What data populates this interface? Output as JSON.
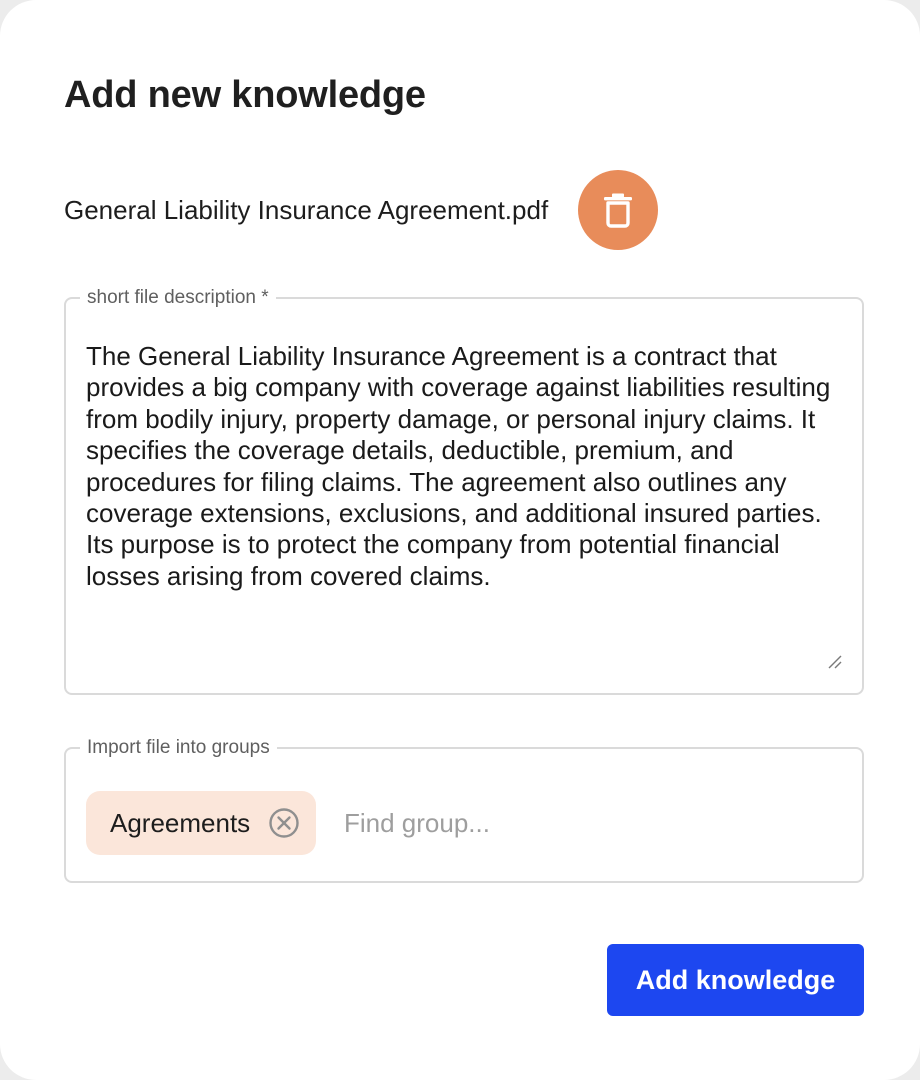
{
  "dialog": {
    "title": "Add new knowledge"
  },
  "file": {
    "name": "General Liability Insurance Agreement.pdf",
    "delete_icon": "trash-icon",
    "delete_color": "#e88c5a"
  },
  "description": {
    "label": "short file description *",
    "value": "The General Liability Insurance Agreement is a contract that provides a big company with coverage against liabilities resulting from bodily injury, property damage, or personal injury claims. It specifies the coverage details, deductible, premium, and procedures for filing claims. The agreement also outlines any coverage extensions, exclusions, and additional insured parties. Its purpose is to protect the company from potential financial losses arising from covered claims."
  },
  "groups": {
    "label": "Import file into groups",
    "selected": [
      {
        "label": "Agreements",
        "remove_icon": "circle-x-icon"
      }
    ],
    "search_placeholder": "Find group...",
    "chip_color": "#fbe6da"
  },
  "actions": {
    "submit_label": "Add knowledge",
    "submit_color": "#1d47f0"
  }
}
